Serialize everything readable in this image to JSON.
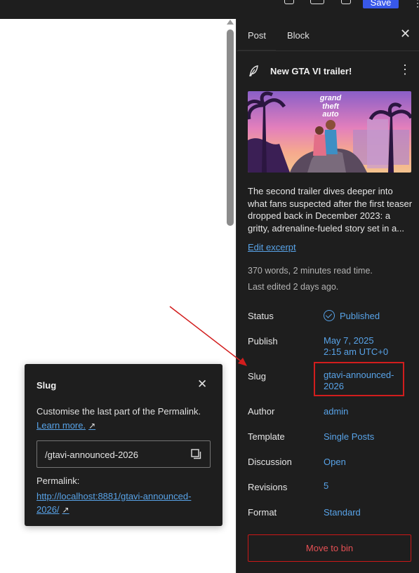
{
  "topbar": {
    "save_label": "Save",
    "more_icon": "more-vertical-icon"
  },
  "sidebar": {
    "tabs": [
      {
        "label": "Post",
        "active": true
      },
      {
        "label": "Block",
        "active": false
      }
    ],
    "close_icon": "close-icon",
    "post": {
      "title": "New GTA VI trailer!",
      "post_icon": "feather-icon",
      "more_icon": "more-vertical-icon",
      "featured_image_alt": "GTA VI key art",
      "excerpt_lines": [
        "The second trailer dives deeper into",
        "what fans suspected after the first teaser",
        "dropped back in December 2023: a",
        "gritty, adrenaline-fueled story set in a..."
      ],
      "edit_excerpt": "Edit excerpt",
      "word_count": "370 words, 2 minutes read time.",
      "last_edited": "Last edited 2 days ago."
    },
    "rows": {
      "status": {
        "label": "Status",
        "value": "Published"
      },
      "publish": {
        "label": "Publish",
        "value_line1": "May 7, 2025",
        "value_line2": "2:15 am UTC+0"
      },
      "slug": {
        "label": "Slug",
        "value_line1": "gtavi-announced-",
        "value_line2": "2026"
      },
      "author": {
        "label": "Author",
        "value": "admin"
      },
      "template": {
        "label": "Template",
        "value": "Single Posts"
      },
      "discussion": {
        "label": "Discussion",
        "value": "Open"
      },
      "revisions": {
        "label": "Revisions",
        "value": "5"
      },
      "format": {
        "label": "Format",
        "value": "Standard"
      }
    },
    "move_to_bin": "Move to bin"
  },
  "slug_popover": {
    "title": "Slug",
    "description": "Customise the last part of the Permalink.",
    "learn_more": "Learn more.",
    "learn_more_arrow": "↗",
    "input_value": "/gtavi-announced-2026",
    "copy_icon": "copy-icon",
    "permalink_label": "Permalink:",
    "permalink_line1": "http://localhost:8881/gtavi-announced-",
    "permalink_line2": "2026/",
    "permalink_arrow": "↗"
  },
  "colors": {
    "sidebar_bg": "#1e1e1e",
    "link_blue": "#58a3e8",
    "annotation_red": "#d21d1d",
    "danger_red": "#cc1818"
  }
}
